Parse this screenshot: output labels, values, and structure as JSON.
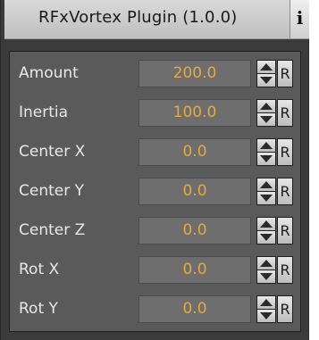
{
  "header": {
    "title": "RFxVortex Plugin (1.0.0)",
    "info_label": "i"
  },
  "colors": {
    "panel_bg": "#3b3b3b",
    "group_bg": "#5a5a5a",
    "value_text": "#e8a93a",
    "label_text": "#e8e8e8"
  },
  "params": [
    {
      "label": "Amount",
      "value": "200.0",
      "reset": "R"
    },
    {
      "label": "Inertia",
      "value": "100.0",
      "reset": "R"
    },
    {
      "label": "Center X",
      "value": "0.0",
      "reset": "R"
    },
    {
      "label": "Center Y",
      "value": "0.0",
      "reset": "R"
    },
    {
      "label": "Center Z",
      "value": "0.0",
      "reset": "R"
    },
    {
      "label": "Rot X",
      "value": "0.0",
      "reset": "R"
    },
    {
      "label": "Rot Y",
      "value": "0.0",
      "reset": "R"
    }
  ]
}
